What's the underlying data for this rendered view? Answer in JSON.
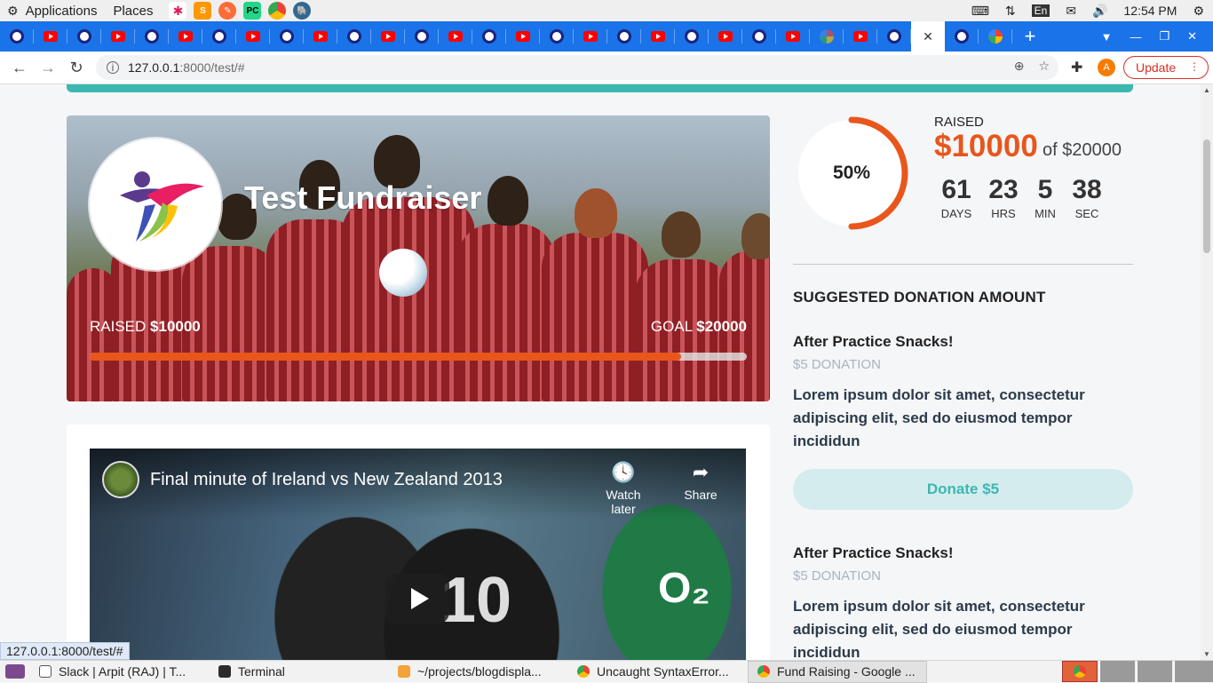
{
  "os_bar": {
    "applications": "Applications",
    "places": "Places",
    "lang": "En",
    "time": "12:54 PM"
  },
  "browser": {
    "url_host": "127.0.0.1",
    "url_rest": ":8000/test/#",
    "update_label": "Update",
    "avatar_letter": "A"
  },
  "hero": {
    "title": "Test Fundraiser",
    "raised_label": "RAISED",
    "raised_value": "$10000",
    "goal_label": "GOAL",
    "goal_value": "$20000",
    "progress": 0.9
  },
  "video": {
    "title": "Final minute of Ireland vs New Zealand 2013",
    "watch_later": "Watch later",
    "share": "Share",
    "jersey_text": "O₂",
    "jersey_number": "10"
  },
  "summary": {
    "percent": "50%",
    "percent_value": 0.5,
    "raised_label": "RAISED",
    "raised_amount": "$10000",
    "of_goal": "of $20000",
    "countdown": [
      {
        "value": "61",
        "unit": "DAYS"
      },
      {
        "value": "23",
        "unit": "HRS"
      },
      {
        "value": "5",
        "unit": "MIN"
      },
      {
        "value": "38",
        "unit": "SEC"
      }
    ]
  },
  "donations": {
    "heading": "SUGGESTED DONATION AMOUNT",
    "items": [
      {
        "title": "After Practice Snacks!",
        "subtitle": "$5 DONATION",
        "description": "Lorem ipsum dolor sit amet, consectetur adipiscing elit, sed do eiusmod tempor incididun",
        "button": "Donate $5"
      },
      {
        "title": "After Practice Snacks!",
        "subtitle": "$5 DONATION",
        "description": "Lorem ipsum dolor sit amet, consectetur adipiscing elit, sed do eiusmod tempor incididun"
      }
    ]
  },
  "status_url": "127.0.0.1:8000/test/#",
  "taskbar": {
    "items": [
      {
        "label": "Slack | Arpit (RAJ) | T...",
        "color": "#4a154b"
      },
      {
        "label": "Terminal",
        "color": "#2c2c2c"
      },
      {
        "label": "~/projects/blogdispla...",
        "color": "#f4a23a"
      },
      {
        "label": "Uncaught SyntaxError...",
        "color": "#4285f4"
      },
      {
        "label": "Fund Raising - Google ...",
        "color": "#4285f4"
      }
    ]
  },
  "colors": {
    "accent_orange": "#e8561c",
    "teal": "#3bb8b1",
    "chrome_blue": "#1a73e8"
  }
}
